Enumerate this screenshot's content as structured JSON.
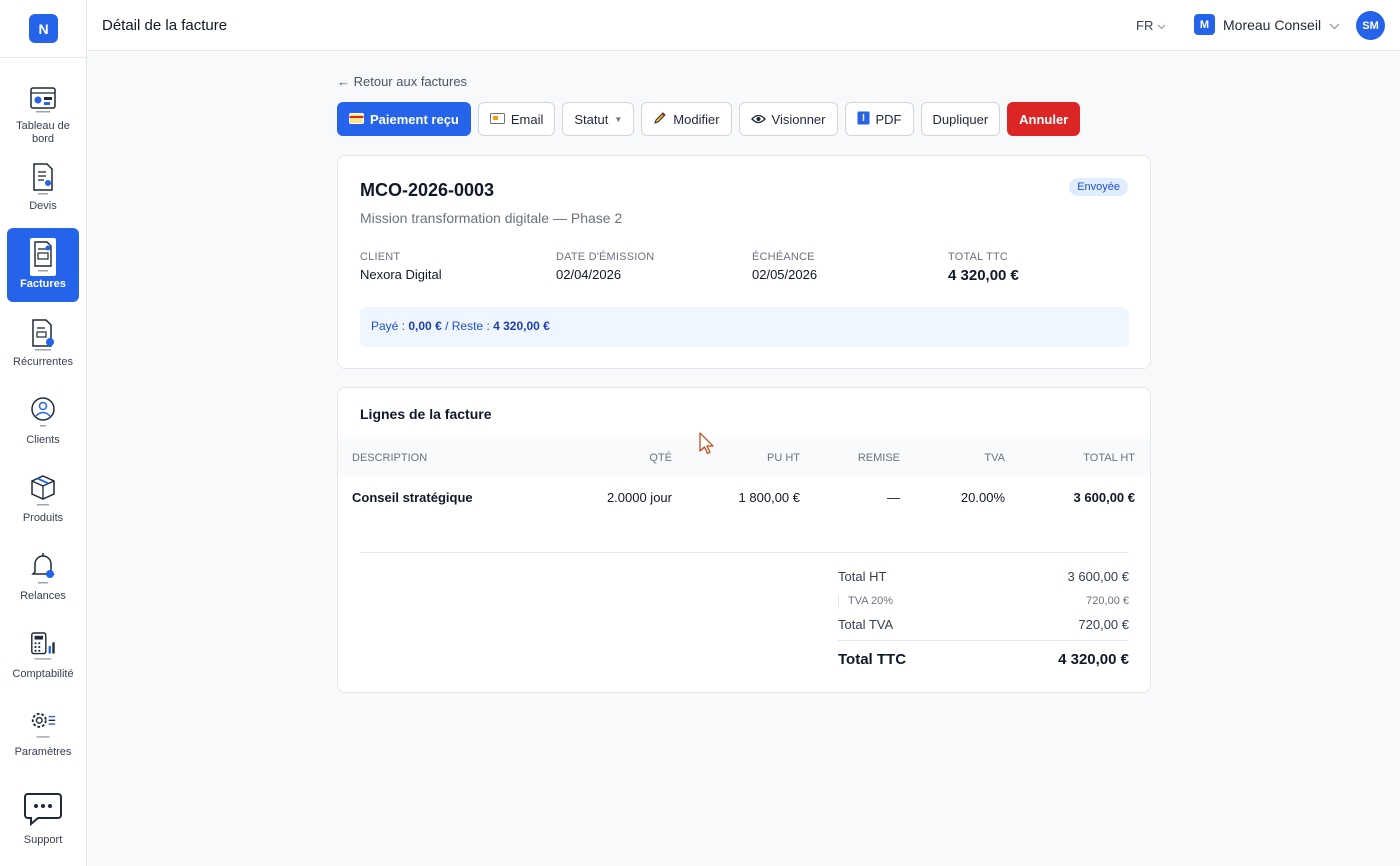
{
  "brand": {
    "letter": "N"
  },
  "sidebar": {
    "items": [
      {
        "name": "dashboard",
        "label": "Tableau de bord",
        "icon": "dashboard-icon",
        "active": false
      },
      {
        "name": "quotes",
        "label": "Devis",
        "icon": "quote-document-icon",
        "active": false
      },
      {
        "name": "invoices",
        "label": "Factures",
        "icon": "invoice-document-icon",
        "active": true
      },
      {
        "name": "recurring",
        "label": "Récurrentes",
        "icon": "recurring-invoice-icon",
        "active": false
      },
      {
        "name": "clients",
        "label": "Clients",
        "icon": "client-user-icon",
        "active": false
      },
      {
        "name": "products",
        "label": "Produits",
        "icon": "product-box-icon",
        "active": false
      },
      {
        "name": "reminders",
        "label": "Relances",
        "icon": "bell-icon",
        "active": false
      },
      {
        "name": "accounting",
        "label": "Comptabilité",
        "icon": "calculator-icon",
        "active": false
      },
      {
        "name": "settings",
        "label": "Paramètres",
        "icon": "gear-icon",
        "active": false
      }
    ],
    "support": {
      "label": "Support",
      "icon": "chat-bubble-icon"
    }
  },
  "header": {
    "title": "Détail de la facture",
    "lang": "FR",
    "company_initial": "M",
    "company_name": "Moreau Conseil",
    "user_initials": "SM"
  },
  "back_link": "← Retour aux factures",
  "actions": {
    "payment": "Paiement reçu",
    "email": "Email",
    "status": "Statut",
    "edit": "Modifier",
    "preview": "Visionner",
    "pdf": "PDF",
    "duplicate": "Dupliquer",
    "cancel": "Annuler"
  },
  "invoice": {
    "number": "MCO-2026-0003",
    "description": "Mission transformation digitale — Phase 2",
    "status": "Envoyée",
    "client_label": "CLIENT",
    "client": "Nexora Digital",
    "issue_label": "DATE D'ÉMISSION",
    "issue_date": "02/04/2026",
    "due_label": "ÉCHÉANCE",
    "due_date": "02/05/2026",
    "total_label": "TOTAL TTC",
    "total": "4 320,00 €",
    "paid_prefix": "Payé :",
    "paid": "0,00 €",
    "remaining_prefix": "/ Reste :",
    "remaining": "4 320,00 €"
  },
  "lines": {
    "title": "Lignes de la facture",
    "columns": [
      "DESCRIPTION",
      "QTÉ",
      "PU HT",
      "REMISE",
      "TVA",
      "TOTAL HT"
    ],
    "rows": [
      {
        "description": "Conseil stratégique",
        "qty": "2.0000 jour",
        "unit_price": "1 800,00 €",
        "discount": "—",
        "vat": "20.00%",
        "total": "3 600,00 €"
      }
    ]
  },
  "totals": {
    "ht_label": "Total HT",
    "ht": "3 600,00 €",
    "vat20_label": "TVA 20%",
    "vat20": "720,00 €",
    "vat_label": "Total TVA",
    "vat": "720,00 €",
    "ttc_label": "Total TTC",
    "ttc": "4 320,00 €"
  },
  "colors": {
    "accent": "#2563eb",
    "danger": "#dc2626"
  }
}
